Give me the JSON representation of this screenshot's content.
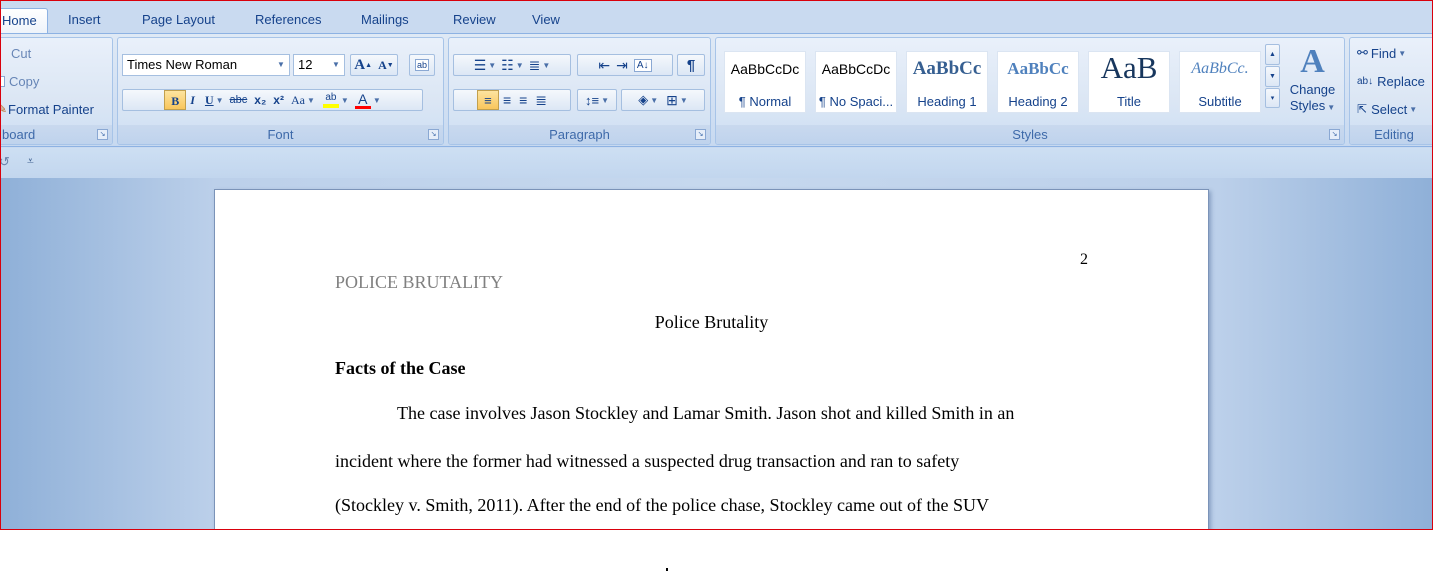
{
  "tabs": [
    "Home",
    "Insert",
    "Page Layout",
    "References",
    "Mailings",
    "Review",
    "View"
  ],
  "clipboard": {
    "cut": "Cut",
    "copy": "Copy",
    "format_painter": "Format Painter",
    "label": "board"
  },
  "font": {
    "name": "Times New Roman",
    "size": "12",
    "bold": "B",
    "italic": "I",
    "underline": "U",
    "strikethrough": "abc",
    "subscript": "x₂",
    "superscript": "x²",
    "change_case": "Aa",
    "grow": "A",
    "shrink": "A",
    "highlight": "ab",
    "font_color": "A",
    "label": "Font"
  },
  "paragraph": {
    "show_marks": "¶",
    "label": "Paragraph"
  },
  "styles": {
    "items": [
      {
        "sample": "AaBbCcDc",
        "name": "¶ Normal"
      },
      {
        "sample": "AaBbCcDc",
        "name": "¶ No Spaci..."
      },
      {
        "sample": "AaBbCc",
        "name": "Heading 1"
      },
      {
        "sample": "AaBbCc",
        "name": "Heading 2"
      },
      {
        "sample": "AaB",
        "name": "Title"
      },
      {
        "sample": "AaBbCc.",
        "name": "Subtitle"
      }
    ],
    "change_styles_line1": "Change",
    "change_styles_line2": "Styles",
    "label": "Styles"
  },
  "editing": {
    "find": "Find",
    "replace": "Replace",
    "select": "Select",
    "label": "Editing"
  },
  "document": {
    "page_number": "2",
    "running_head": "POLICE BRUTALITY",
    "title": "Police Brutality",
    "heading": "Facts of the Case",
    "lines": [
      "The case involves Jason Stockley and Lamar Smith. Jason shot and killed Smith in an",
      "incident where the former had witnessed a suspected drug transaction and ran to safety",
      "(Stockley v. Smith, 2011). After the end of the police chase, Stockley came out of the SUV"
    ]
  },
  "colors": {
    "frame_border": "#d9000c",
    "ribbon_text": "#15428b",
    "highlight": "#ffff00",
    "font_color_bar": "#ff0000"
  }
}
